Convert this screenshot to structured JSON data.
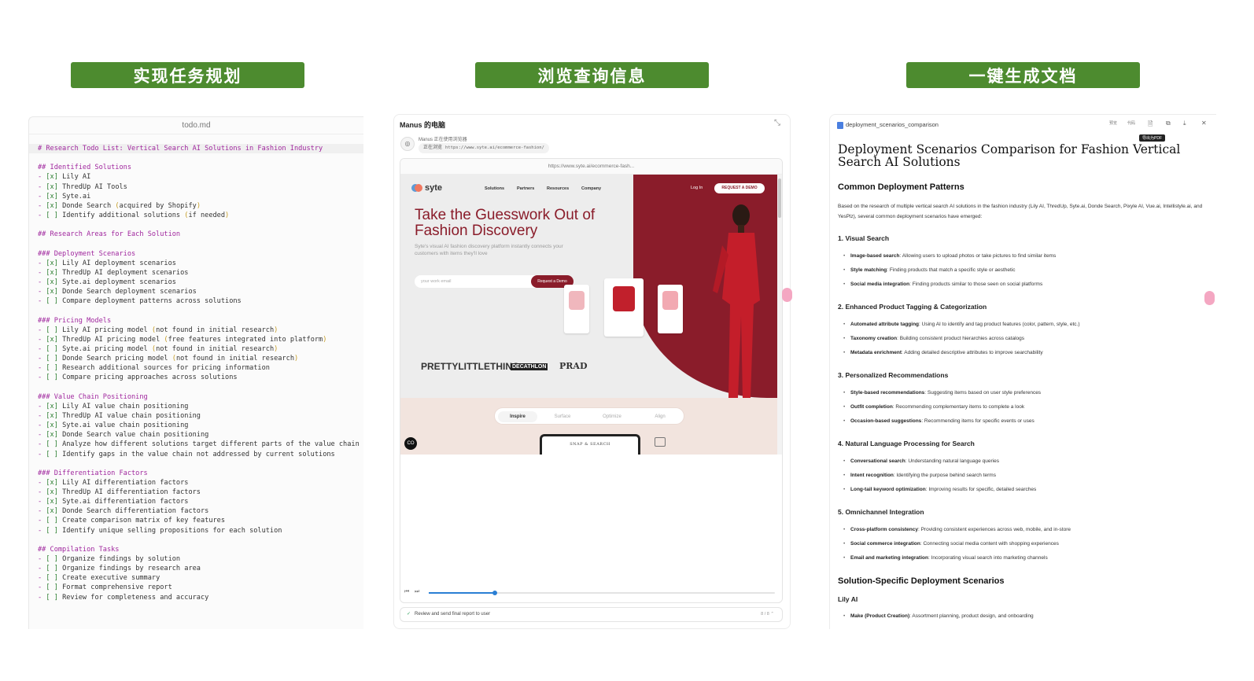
{
  "labels": {
    "plan": "实现任务规划",
    "browse": "浏览查询信息",
    "doc": "一键生成文档"
  },
  "todo": {
    "filename": "todo.md",
    "lines": [
      {
        "t": "# Research Todo List: Vertical Search AI Solutions in Fashion Industry",
        "k": "h1"
      },
      {
        "t": "",
        "k": "gap"
      },
      {
        "t": "## Identified Solutions",
        "k": "h"
      },
      {
        "t": "- [x] Lily AI",
        "k": "i"
      },
      {
        "t": "- [x] ThredUp AI Tools",
        "k": "i"
      },
      {
        "t": "- [x] Syte.ai",
        "k": "i"
      },
      {
        "t": "- [x] Donde Search (acquired by Shopify)",
        "k": "i"
      },
      {
        "t": "- [ ] Identify additional solutions (if needed)",
        "k": "i"
      },
      {
        "t": "",
        "k": "gap"
      },
      {
        "t": "## Research Areas for Each Solution",
        "k": "h"
      },
      {
        "t": "",
        "k": "gap"
      },
      {
        "t": "### Deployment Scenarios",
        "k": "h"
      },
      {
        "t": "- [x] Lily AI deployment scenarios",
        "k": "i"
      },
      {
        "t": "- [x] ThredUp AI deployment scenarios",
        "k": "i"
      },
      {
        "t": "- [x] Syte.ai deployment scenarios",
        "k": "i"
      },
      {
        "t": "- [x] Donde Search deployment scenarios",
        "k": "i"
      },
      {
        "t": "- [ ] Compare deployment patterns across solutions",
        "k": "i"
      },
      {
        "t": "",
        "k": "gap"
      },
      {
        "t": "### Pricing Models",
        "k": "h"
      },
      {
        "t": "- [ ] Lily AI pricing model (not found in initial research)",
        "k": "i"
      },
      {
        "t": "- [x] ThredUp AI pricing model (free features integrated into platform)",
        "k": "i"
      },
      {
        "t": "- [ ] Syte.ai pricing model (not found in initial research)",
        "k": "i"
      },
      {
        "t": "- [ ] Donde Search pricing model (not found in initial research)",
        "k": "i"
      },
      {
        "t": "- [ ] Research additional sources for pricing information",
        "k": "i"
      },
      {
        "t": "- [ ] Compare pricing approaches across solutions",
        "k": "i"
      },
      {
        "t": "",
        "k": "gap"
      },
      {
        "t": "### Value Chain Positioning",
        "k": "h"
      },
      {
        "t": "- [x] Lily AI value chain positioning",
        "k": "i"
      },
      {
        "t": "- [x] ThredUp AI value chain positioning",
        "k": "i"
      },
      {
        "t": "- [x] Syte.ai value chain positioning",
        "k": "i"
      },
      {
        "t": "- [x] Donde Search value chain positioning",
        "k": "i"
      },
      {
        "t": "- [ ] Analyze how different solutions target different parts of the value chain",
        "k": "i"
      },
      {
        "t": "- [ ] Identify gaps in the value chain not addressed by current solutions",
        "k": "i"
      },
      {
        "t": "",
        "k": "gap"
      },
      {
        "t": "### Differentiation Factors",
        "k": "h"
      },
      {
        "t": "- [x] Lily AI differentiation factors",
        "k": "i"
      },
      {
        "t": "- [x] ThredUp AI differentiation factors",
        "k": "i"
      },
      {
        "t": "- [x] Syte.ai differentiation factors",
        "k": "i"
      },
      {
        "t": "- [x] Donde Search differentiation factors",
        "k": "i"
      },
      {
        "t": "- [ ] Create comparison matrix of key features",
        "k": "i"
      },
      {
        "t": "- [ ] Identify unique selling propositions for each solution",
        "k": "i"
      },
      {
        "t": "",
        "k": "gap"
      },
      {
        "t": "## Compilation Tasks",
        "k": "h"
      },
      {
        "t": "- [ ] Organize findings by solution",
        "k": "i"
      },
      {
        "t": "- [ ] Organize findings by research area",
        "k": "i"
      },
      {
        "t": "- [ ] Create executive summary",
        "k": "i"
      },
      {
        "t": "- [ ] Format comprehensive report",
        "k": "i"
      },
      {
        "t": "- [ ] Review for completeness and accuracy",
        "k": "i"
      }
    ]
  },
  "manus": {
    "title": "Manus 的电脑",
    "using": "Manus 正在使用浏览器",
    "browsing": "正在浏览",
    "url_short": "https://www.syte.ai/ecommerce-fashion/",
    "url_bar": "https://www.syte.ai/ecommerce-fash...",
    "site": {
      "logo": "syte",
      "nav": [
        "Solutions",
        "Partners",
        "Resources",
        "Company"
      ],
      "login": "Log In",
      "request_btn": "REQUEST A DEMO",
      "hero": "Take the Guesswork Out of Fashion Discovery",
      "sub": "Syte's visual AI fashion discovery platform instantly connects your customers with items they'll love",
      "email_placeholder": "your work email",
      "demo_btn": "Request a Demo",
      "brands": [
        "PRETTYLITTLETHING",
        "DECATHLON",
        "PRAD"
      ],
      "tabs": [
        "Inspire",
        "Surface",
        "Optimize",
        "Align"
      ],
      "device_text": "SNAP & SEARCH",
      "co": "CO"
    },
    "status": "Review and send final report to user",
    "step": "8 / 8",
    "progress": 0.19
  },
  "doc": {
    "filename": "deployment_scenarios_comparison",
    "toolbar": [
      "预览",
      "代码"
    ],
    "tooltip": "导出为PDF",
    "title": "Deployment Scenarios Comparison for Fashion Vertical Search AI Solutions",
    "h_common": "Common Deployment Patterns",
    "intro": "Based on the research of multiple vertical search AI solutions in the fashion industry (Lily AI, ThredUp, Syte.ai, Donde Search, Pixyle AI, Vue.ai, Intellistyle.ai, and YesPlz), several common deployment scenarios have emerged:",
    "sections": [
      {
        "title": "1. Visual Search",
        "items": [
          {
            "b": "Image-based search",
            "t": ": Allowing users to upload photos or take pictures to find similar items"
          },
          {
            "b": "Style matching",
            "t": ": Finding products that match a specific style or aesthetic"
          },
          {
            "b": "Social media integration",
            "t": ": Finding products similar to those seen on social platforms"
          }
        ]
      },
      {
        "title": "2. Enhanced Product Tagging & Categorization",
        "items": [
          {
            "b": "Automated attribute tagging",
            "t": ": Using AI to identify and tag product features (color, pattern, style, etc.)"
          },
          {
            "b": "Taxonomy creation",
            "t": ": Building consistent product hierarchies across catalogs"
          },
          {
            "b": "Metadata enrichment",
            "t": ": Adding detailed descriptive attributes to improve searchability"
          }
        ]
      },
      {
        "title": "3. Personalized Recommendations",
        "items": [
          {
            "b": "Style-based recommendations",
            "t": ": Suggesting items based on user style preferences"
          },
          {
            "b": "Outfit completion",
            "t": ": Recommending complementary items to complete a look"
          },
          {
            "b": "Occasion-based suggestions",
            "t": ": Recommending items for specific events or uses"
          }
        ]
      },
      {
        "title": "4. Natural Language Processing for Search",
        "items": [
          {
            "b": "Conversational search",
            "t": ": Understanding natural language queries"
          },
          {
            "b": "Intent recognition",
            "t": ": Identifying the purpose behind search terms"
          },
          {
            "b": "Long-tail keyword optimization",
            "t": ": Improving results for specific, detailed searches"
          }
        ]
      },
      {
        "title": "5. Omnichannel Integration",
        "items": [
          {
            "b": "Cross-platform consistency",
            "t": ": Providing consistent experiences across web, mobile, and in-store"
          },
          {
            "b": "Social commerce integration",
            "t": ": Connecting social media content with shopping experiences"
          },
          {
            "b": "Email and marketing integration",
            "t": ": Incorporating visual search into marketing channels"
          }
        ]
      }
    ],
    "h_specific": "Solution-Specific Deployment Scenarios",
    "lily": "Lily AI",
    "last_item_b": "Make (Product Creation)",
    "last_item_t": ": Assortment planning, product design, and onboarding"
  }
}
